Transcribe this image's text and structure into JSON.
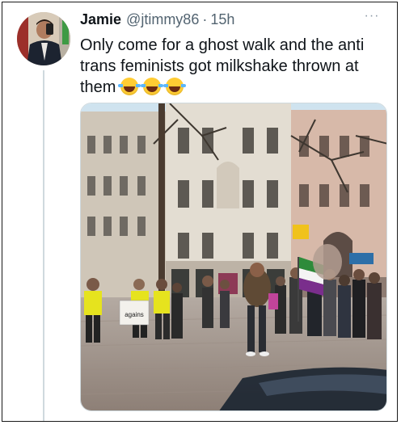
{
  "tweet": {
    "author_name": "Jamie",
    "handle": "@jtimmy86",
    "separator": "·",
    "time": "15h",
    "text": "Only come for a ghost walk and the anti trans feminists got milkshake thrown at them",
    "emojis": [
      "face-with-tears-of-joy",
      "face-with-tears-of-joy",
      "face-with-tears-of-joy"
    ],
    "more_icon": "more-icon",
    "sign_text": "agains"
  },
  "colors": {
    "text": "#0f1419",
    "secondary": "#536471",
    "thread_line": "#cfd9de",
    "flag_green": "#2e8b3a",
    "flag_white": "#f4f4f4",
    "flag_purple": "#7a2e8c",
    "hi_vis": "#e6e31e"
  }
}
